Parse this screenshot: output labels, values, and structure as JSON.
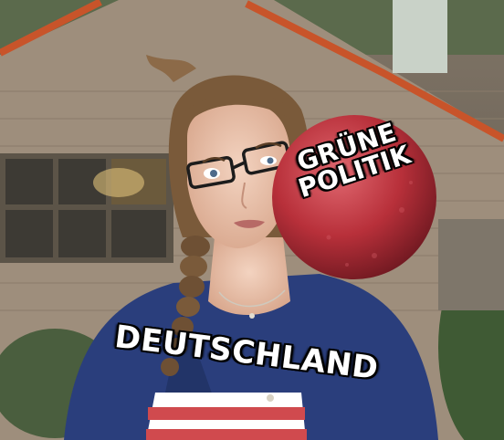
{
  "meme": {
    "ball_label_line1": "GRÜNE",
    "ball_label_line2": "POLITIK",
    "person_label": "DEUTSCHLAND"
  },
  "colors": {
    "ball": "#b8303a",
    "sweater": "#2a3e7c",
    "house_wall": "#9e8e7c",
    "roof_trim": "#c8542a",
    "hair": "#7a5a3a"
  }
}
